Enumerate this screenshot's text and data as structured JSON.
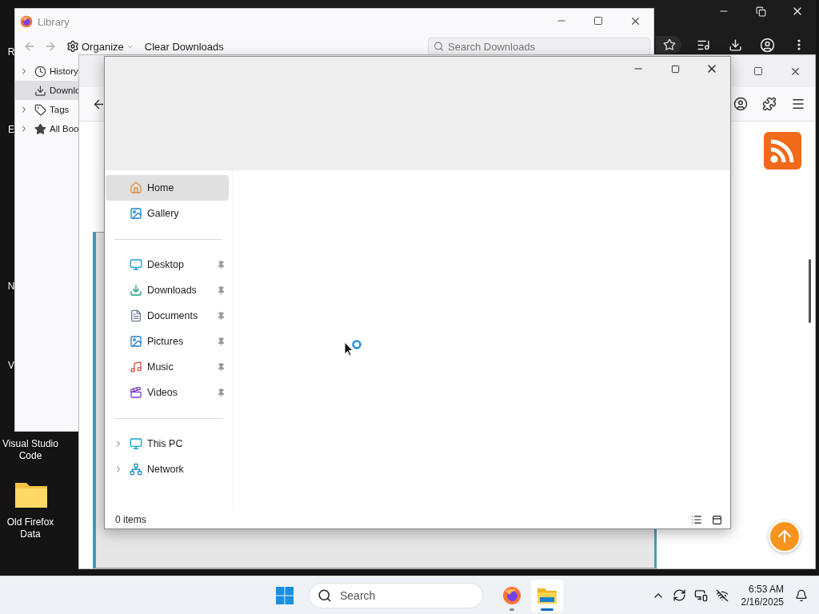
{
  "desktop_icons": [
    {
      "label": "R"
    },
    {
      "label": "E"
    },
    {
      "label": "N"
    },
    {
      "label": "V"
    },
    {
      "label": "Visual Studio Code"
    },
    {
      "label": "Old Firefox Data"
    }
  ],
  "library": {
    "title": "Library",
    "organize": "Organize",
    "clear_button": "Clear Downloads",
    "search": {
      "placeholder": "Search Downloads"
    },
    "sidebar": [
      {
        "label": "History",
        "expandable": true,
        "selected": false
      },
      {
        "label": "Downlo",
        "expandable": false,
        "selected": true
      },
      {
        "label": "Tags",
        "expandable": true,
        "selected": false
      },
      {
        "label": "All Boo",
        "expandable": true,
        "selected": false
      }
    ]
  },
  "explorer": {
    "sidebar_groups": [
      [
        {
          "label": "Home",
          "selected": true,
          "expandable": false,
          "pinned": false
        },
        {
          "label": "Gallery",
          "selected": false,
          "expandable": false,
          "pinned": false
        }
      ],
      [
        {
          "label": "Desktop",
          "selected": false,
          "expandable": false,
          "pinned": true
        },
        {
          "label": "Downloads",
          "selected": false,
          "expandable": false,
          "pinned": true
        },
        {
          "label": "Documents",
          "selected": false,
          "expandable": false,
          "pinned": true
        },
        {
          "label": "Pictures",
          "selected": false,
          "expandable": false,
          "pinned": true
        },
        {
          "label": "Music",
          "selected": false,
          "expandable": false,
          "pinned": true
        },
        {
          "label": "Videos",
          "selected": false,
          "expandable": false,
          "pinned": true
        }
      ],
      [
        {
          "label": "This PC",
          "selected": false,
          "expandable": true,
          "pinned": false
        },
        {
          "label": "Network",
          "selected": false,
          "expandable": true,
          "pinned": false
        }
      ]
    ],
    "status": "0 items"
  },
  "taskbar": {
    "search": {
      "placeholder": "Search"
    },
    "apps": [
      {
        "selected": false
      },
      {
        "selected": true
      }
    ],
    "time": "6:53 AM",
    "date": "2/16/2025"
  }
}
